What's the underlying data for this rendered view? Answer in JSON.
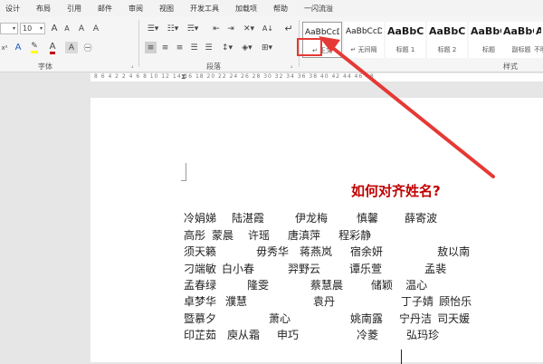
{
  "menu": [
    "设计",
    "布局",
    "引用",
    "邮件",
    "审阅",
    "视图",
    "开发工具",
    "加载项",
    "帮助",
    "一闪流溢"
  ],
  "font": {
    "name_value": "",
    "size_value": "10",
    "grow": "A",
    "shrink": "A",
    "highlight": "A",
    "color": "A",
    "format_a": "A",
    "format_b": "A"
  },
  "paragraph_ctrls": {
    "sort": "A↓",
    "show_marks": "↵"
  },
  "styles": [
    {
      "preview": "AaBbCcDı",
      "name": "↵ 正文"
    },
    {
      "preview": "AaBbCcDı",
      "name": "↵ 无间隔"
    },
    {
      "preview": "AaBbCc",
      "name": "标题 1"
    },
    {
      "preview": "AaBbC",
      "name": "标题 2"
    },
    {
      "preview": "AaBbC",
      "name": "标题"
    },
    {
      "preview": "AaBbC",
      "name": "副标题"
    },
    {
      "preview": "AaBb",
      "name": "不明"
    }
  ],
  "group_labels": {
    "font": "字体",
    "paragraph": "段落",
    "styles": "样式"
  },
  "ruler": {
    "numbers": "8  6  4  2     2  4  6  8  10  12  14  16  18  20  22  24  26  28  30  32  34  36  38  40  42  44  46  48"
  },
  "document": {
    "title": "如何对齐姓名?",
    "lines": [
      [
        "冷娟娣",
        "陆湛霞",
        "伊龙梅",
        "慎馨",
        "薛寄波"
      ],
      [
        "高彤",
        "蒙晨",
        "许瑶",
        "唐滇萍",
        "程彩静"
      ],
      [
        "须天籁",
        "毋秀华",
        "蒋燕岚",
        "宿余妍",
        "敖以南"
      ],
      [
        "刁端敏",
        "白小春",
        "羿野云",
        "谭乐萱",
        "孟裴"
      ],
      [
        "孟春绿",
        "隆雯",
        "蔡慧晨",
        "储颖",
        "温心"
      ],
      [
        "卓梦华",
        "濮慧",
        "袁丹",
        "丁子婧",
        "顾怡乐"
      ],
      [
        "暨慕夕",
        "萧心",
        "姚南露",
        "宁丹洁",
        "司天媛"
      ],
      [
        "印芷茹",
        "庾从霜",
        "申巧",
        "冷菱",
        "弘玛珍"
      ]
    ]
  }
}
